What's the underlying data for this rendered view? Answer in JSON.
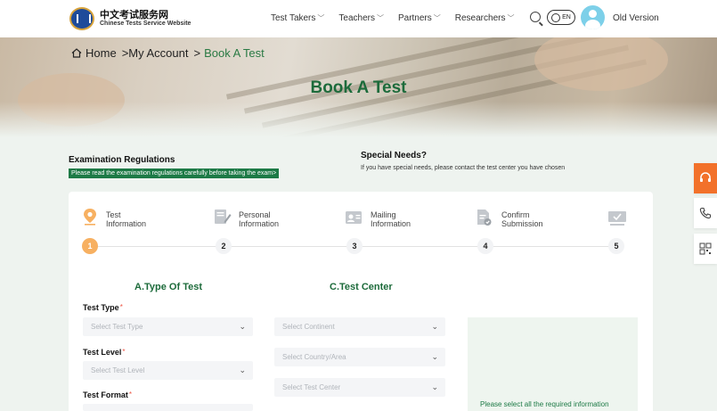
{
  "header": {
    "logo_cn": "中文考试服务网",
    "logo_en": "Chinese Tests Service Website",
    "nav": [
      {
        "label": "Test Takers"
      },
      {
        "label": "Teachers"
      },
      {
        "label": "Partners"
      },
      {
        "label": "Researchers"
      }
    ],
    "lang": "EN",
    "old_version": "Old Version"
  },
  "banner": {
    "breadcrumb": {
      "home": "Home",
      "sep1": ">",
      "account": "My Account",
      "sep2": ">",
      "current": "Book A Test"
    },
    "title": "Book A Test"
  },
  "regulations": {
    "title": "Examination Regulations",
    "link": "Please read the examination regulations carefully before taking the exam>"
  },
  "special_needs": {
    "title": "Special Needs?",
    "text": "If you have special needs, please contact the test center you have chosen"
  },
  "steps": [
    {
      "label_1": "Test",
      "label_2": "Information",
      "num": "1",
      "icon": "location-pin-icon"
    },
    {
      "label_1": "Personal",
      "label_2": "Information",
      "num": "2",
      "icon": "edit-document-icon"
    },
    {
      "label_1": "Mailing",
      "label_2": "Information",
      "num": "3",
      "icon": "id-card-icon"
    },
    {
      "label_1": "Confirm",
      "label_2": "Submission",
      "num": "4",
      "icon": "document-check-icon"
    },
    {
      "label_1": "",
      "label_2": "",
      "num": "5",
      "icon": "monitor-check-icon"
    }
  ],
  "form": {
    "section_a": "A.Type Of Test",
    "section_c": "C.Test Center",
    "test_type_label": "Test Type",
    "test_type_placeholder": "Select Test Type",
    "test_level_label": "Test Level",
    "test_level_placeholder": "Select Test Level",
    "test_format_label": "Test Format",
    "continent_placeholder": "Select Continent",
    "country_placeholder": "Select Country/Area",
    "center_placeholder": "Select Test Center",
    "required_mark": "*",
    "info_text": "Please select all the required information"
  },
  "colors": {
    "brand_green": "#1d6b3b",
    "accent_orange": "#f7b061",
    "side_orange": "#f2712a"
  }
}
